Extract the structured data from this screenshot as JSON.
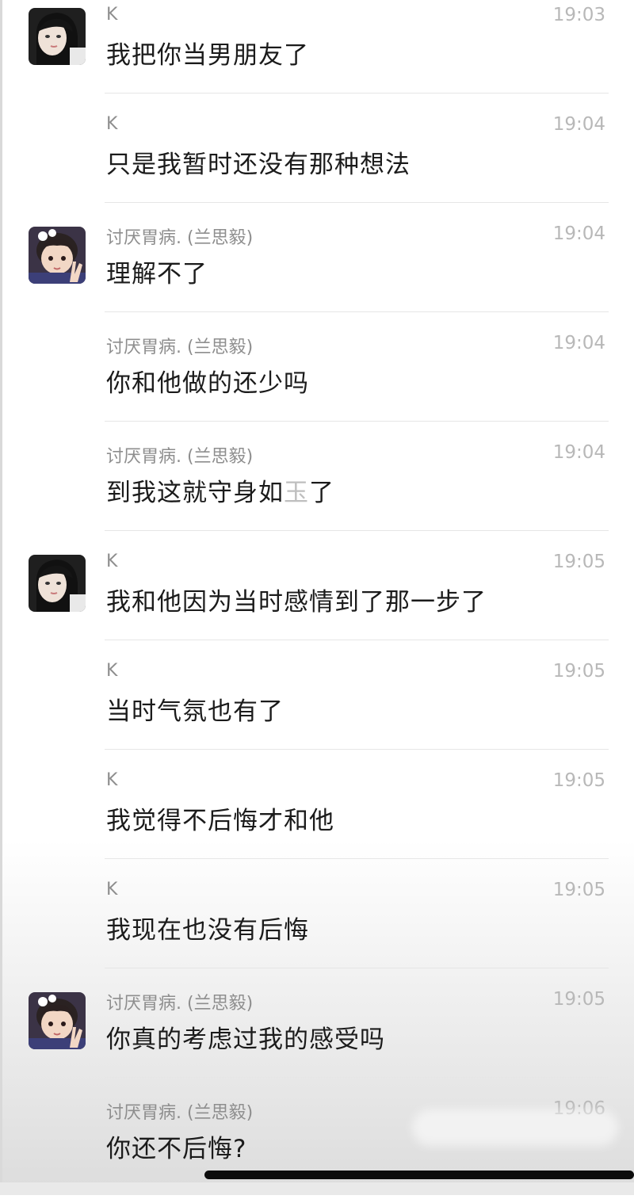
{
  "chat": {
    "messages": [
      {
        "sender": "K",
        "time": "19:03",
        "text": "我把你当男朋友了",
        "avatar": "k-avatar"
      },
      {
        "sender": "K",
        "time": "19:04",
        "text": "只是我暂时还没有那种想法",
        "avatar": ""
      },
      {
        "sender": "讨厌胃病. (兰思毅)",
        "time": "19:04",
        "text": "理解不了",
        "avatar": "child-avatar"
      },
      {
        "sender": "讨厌胃病. (兰思毅)",
        "time": "19:04",
        "text": "你和他做的还少吗",
        "avatar": ""
      },
      {
        "sender": "讨厌胃病. (兰思毅)",
        "time": "19:04",
        "text_main": "到我这就守身如",
        "text_faint": "玉",
        "text_end": "了",
        "avatar": ""
      },
      {
        "sender": "K",
        "time": "19:05",
        "text": "我和他因为当时感情到了那一步了",
        "avatar": "k-avatar"
      },
      {
        "sender": "K",
        "time": "19:05",
        "text": "当时气氛也有了",
        "avatar": ""
      },
      {
        "sender": "K",
        "time": "19:05",
        "text": "我觉得不后悔才和他",
        "avatar": ""
      },
      {
        "sender": "K",
        "time": "19:05",
        "text": "我现在也没有后悔",
        "avatar": ""
      },
      {
        "sender": "讨厌胃病. (兰思毅)",
        "time": "19:05",
        "text": "你真的考虑过我的感受吗",
        "avatar": "child-avatar"
      },
      {
        "sender": "讨厌胃病. (兰思毅)",
        "time": "19:06",
        "text": "你还不后悔?",
        "avatar": ""
      }
    ]
  },
  "colors": {
    "sender_text": "#8e8e8e",
    "time_text": "#b8b8b8",
    "message_text": "#1b1b1b",
    "divider": "#e6e6e6"
  }
}
